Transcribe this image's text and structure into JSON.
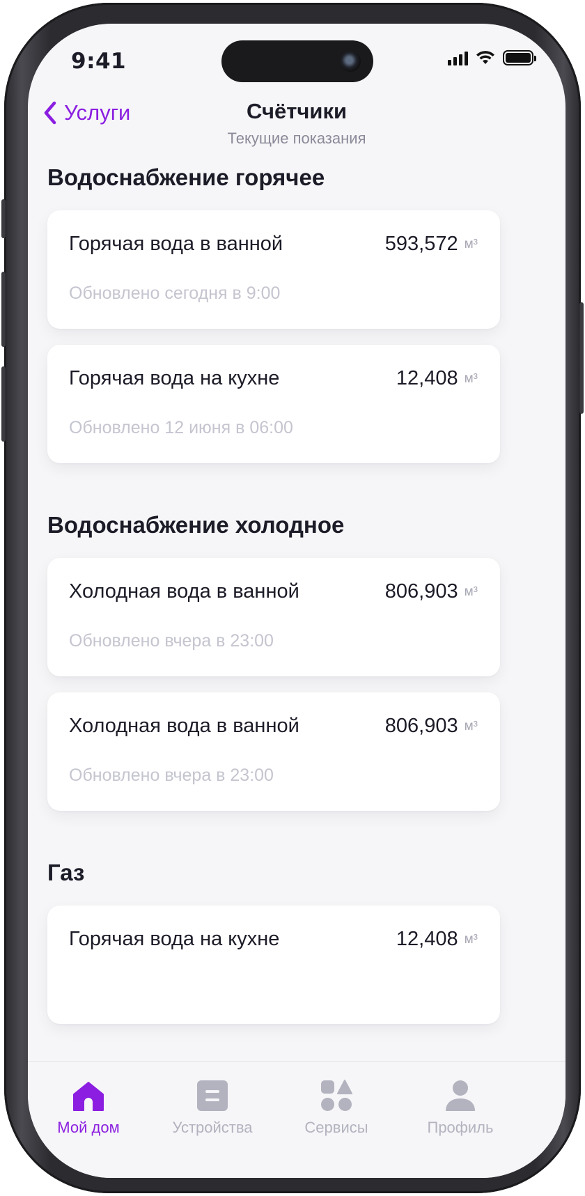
{
  "status_bar": {
    "time": "9:41"
  },
  "nav": {
    "back_label": "Услуги",
    "title": "Счётчики",
    "subtitle": "Текущие показания"
  },
  "sections": [
    {
      "title": "Водоснабжение горячее",
      "meters": [
        {
          "name": "Горячая вода в ванной",
          "value": "593,572",
          "unit": "м³",
          "updated": "Обновлено сегодня в 9:00"
        },
        {
          "name": "Горячая вода на кухне",
          "value": "12,408",
          "unit": "м³",
          "updated": "Обновлено 12 июня в 06:00"
        }
      ]
    },
    {
      "title": "Водоснабжение холодное",
      "meters": [
        {
          "name": "Холодная вода в ванной",
          "value": "806,903",
          "unit": "м³",
          "updated": "Обновлено вчера в 23:00"
        },
        {
          "name": "Холодная вода в ванной",
          "value": "806,903",
          "unit": "м³",
          "updated": "Обновлено вчера в 23:00"
        }
      ]
    },
    {
      "title": "Газ",
      "meters": [
        {
          "name": "Горячая вода на кухне",
          "value": "12,408",
          "unit": "м³",
          "updated": ""
        }
      ]
    }
  ],
  "tabbar": {
    "items": [
      {
        "label": "Мой дом",
        "icon": "home-icon",
        "active": true
      },
      {
        "label": "Устройства",
        "icon": "device-icon",
        "active": false
      },
      {
        "label": "Сервисы",
        "icon": "services-icon",
        "active": false
      },
      {
        "label": "Профиль",
        "icon": "profile-icon",
        "active": false
      }
    ]
  },
  "colors": {
    "accent": "#8b1ee0",
    "inactive": "#b3b3c0",
    "background": "#f6f6f8"
  }
}
